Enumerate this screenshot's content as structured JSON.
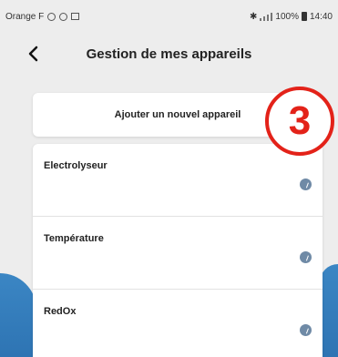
{
  "status_bar": {
    "carrier": "Orange F",
    "battery": "100%",
    "time": "14:40"
  },
  "header": {
    "title": "Gestion de mes appareils"
  },
  "add_device": {
    "label": "Ajouter un nouvel appareil"
  },
  "devices": [
    {
      "name": "Electrolyseur"
    },
    {
      "name": "Température"
    },
    {
      "name": "RedOx"
    }
  ],
  "annotation": {
    "step": "3"
  },
  "colors": {
    "accent_blue": "#2e74b3",
    "annotation_red": "#e32219",
    "background": "#ededed"
  }
}
